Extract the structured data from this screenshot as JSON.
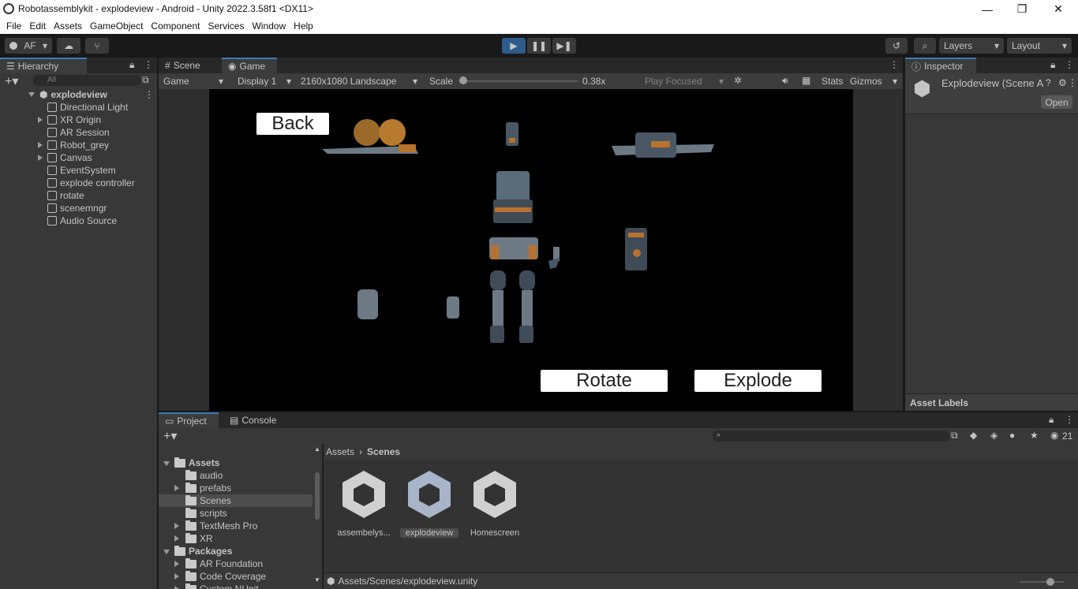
{
  "window": {
    "title": "Robotassemblykit - explodeview - Android - Unity 2022.3.58f1 <DX11>",
    "controls": [
      "—",
      "❐",
      "✕"
    ]
  },
  "menu": [
    "File",
    "Edit",
    "Assets",
    "GameObject",
    "Component",
    "Services",
    "Window",
    "Help"
  ],
  "toolbar": {
    "account": "AF",
    "layers": "Layers",
    "layout": "Layout"
  },
  "hierarchy": {
    "tab": "Hierarchy",
    "search_placeholder": "All",
    "scene": "explodeview",
    "items": [
      {
        "label": "Directional Light",
        "expandable": false
      },
      {
        "label": "XR Origin",
        "expandable": true
      },
      {
        "label": "AR Session",
        "expandable": false
      },
      {
        "label": "Robot_grey",
        "expandable": true
      },
      {
        "label": "Canvas",
        "expandable": true
      },
      {
        "label": "EventSystem",
        "expandable": false
      },
      {
        "label": "explode controller",
        "expandable": false
      },
      {
        "label": "rotate",
        "expandable": false
      },
      {
        "label": "scenemngr",
        "expandable": false
      },
      {
        "label": "Audio Source",
        "expandable": false
      }
    ]
  },
  "game": {
    "tabs": [
      "Scene",
      "Game"
    ],
    "view_select": "Game",
    "display": "Display 1",
    "resolution": "2160x1080 Landscape",
    "scale_label": "Scale",
    "scale_value": "0.38x",
    "play_focused": "Play Focused",
    "stats": "Stats",
    "gizmos": "Gizmos",
    "buttons": {
      "back": "Back",
      "rotate": "Rotate",
      "explode": "Explode"
    }
  },
  "inspector": {
    "tab": "Inspector",
    "object": "Explodeview (Scene A",
    "open": "Open",
    "asset_labels": "Asset Labels"
  },
  "project": {
    "tabs": [
      "Project",
      "Console"
    ],
    "tree": [
      {
        "label": "Assets",
        "level": 0,
        "bold": true,
        "expand": "down"
      },
      {
        "label": "audio",
        "level": 1,
        "expand": "none"
      },
      {
        "label": "prefabs",
        "level": 1,
        "expand": "right"
      },
      {
        "label": "Scenes",
        "level": 1,
        "expand": "none",
        "selected": true
      },
      {
        "label": "scripts",
        "level": 1,
        "expand": "none"
      },
      {
        "label": "TextMesh Pro",
        "level": 1,
        "expand": "right"
      },
      {
        "label": "XR",
        "level": 1,
        "expand": "right"
      },
      {
        "label": "Packages",
        "level": 0,
        "bold": true,
        "expand": "down"
      },
      {
        "label": "AR Foundation",
        "level": 1,
        "expand": "right"
      },
      {
        "label": "Code Coverage",
        "level": 1,
        "expand": "right"
      },
      {
        "label": "Custom NUnit",
        "level": 1,
        "expand": "right"
      }
    ],
    "breadcrumb": [
      "Assets",
      "Scenes"
    ],
    "assets": [
      {
        "label": "assembelys...",
        "selected": false
      },
      {
        "label": "explodeview",
        "selected": true
      },
      {
        "label": "Homescreen",
        "selected": false
      }
    ],
    "hidden_count": "21",
    "path": "Assets/Scenes/explodeview.unity"
  }
}
